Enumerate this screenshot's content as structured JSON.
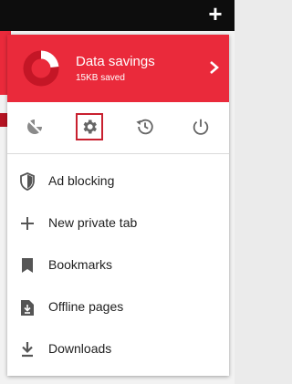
{
  "topbar": {
    "new_tab_glyph": "+"
  },
  "menu": {
    "data_savings": {
      "title": "Data savings",
      "subtitle": "15KB saved",
      "accent": "#ea2a3b"
    },
    "toolbar_icons": [
      {
        "name": "turbo-icon"
      },
      {
        "name": "settings-icon"
      },
      {
        "name": "history-icon"
      },
      {
        "name": "power-icon"
      }
    ],
    "items": [
      {
        "label": "Ad blocking",
        "icon": "shield-icon"
      },
      {
        "label": "New private tab",
        "icon": "plus-icon"
      },
      {
        "label": "Bookmarks",
        "icon": "bookmark-icon"
      },
      {
        "label": "Offline pages",
        "icon": "offline-page-icon"
      },
      {
        "label": "Downloads",
        "icon": "download-icon"
      }
    ]
  }
}
